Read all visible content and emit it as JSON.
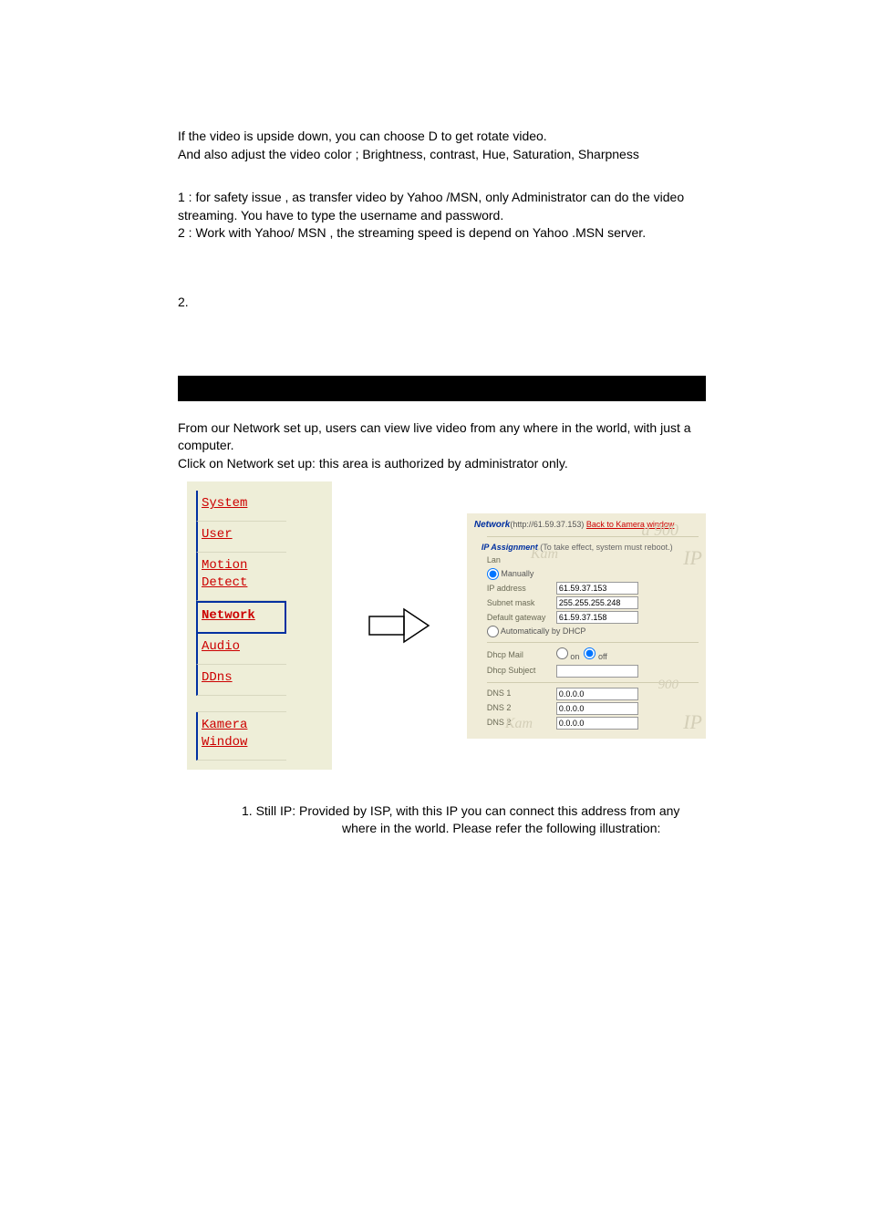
{
  "intro": {
    "p1": "If the video is  upside down, you can choose D to get rotate video.",
    "p2": "And also adjust the video color ; Brightness, contrast, Hue, Saturation, Sharpness",
    "n1": "1 : for safety issue , as transfer video by Yahoo /MSN, only Administrator can do the video streaming. You have to type the username and password.",
    "n2": "2 : Work with Yahoo/ MSN , the streaming speed is depend on Yahoo .MSN server.",
    "sec": "2."
  },
  "network": {
    "p1": "From our Network set up, users can view live video from any where in the world, with just a computer.",
    "p2": "Click on Network set up: this area is authorized by administrator only."
  },
  "sidebar": {
    "items": [
      "System",
      "User",
      "Motion Detect",
      "Network",
      "Audio",
      "DDns",
      "Kamera Window"
    ]
  },
  "netpanel": {
    "title_word": "Network",
    "title_rest": "(http://61.59.37.153) ",
    "back_link": "Back to Kamera window",
    "assign_label": "IP Assignment",
    "assign_note": " (To take effect, system must reboot.)",
    "lan": "Lan",
    "manual": "Manually",
    "ip_label": "IP address",
    "ip_value": "61.59.37.153",
    "mask_label": "Subnet mask",
    "mask_value": "255.255.255.248",
    "gw_label": "Default gateway",
    "gw_value": "61.59.37.158",
    "dhcp_auto": "Automatically by DHCP",
    "dhcp_mail": "Dhcp Mail",
    "dhcp_on": "on",
    "dhcp_off": "off",
    "dhcp_subj": "Dhcp Subject",
    "dns1_label": "DNS 1",
    "dns1_value": "0.0.0.0",
    "dns2_label": "DNS 2",
    "dns2_value": "0.0.0.0",
    "dns3_label": "DNS 3",
    "dns3_value": "0.0.0.0"
  },
  "footnote": {
    "l1": "1. Still IP: Provided by ISP, with this IP you can connect this address from any",
    "l2": "where in the world. Please refer the following illustration:"
  }
}
